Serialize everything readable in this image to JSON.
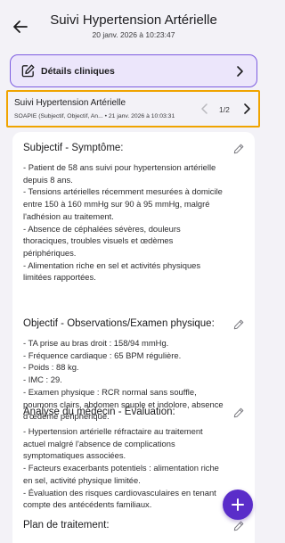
{
  "header": {
    "title": "Suivi Hypertension Artérielle",
    "subtitle": "20 janv. 2026 à 10:23:47"
  },
  "details": {
    "label": "Détails cliniques"
  },
  "note": {
    "title": "Suivi Hypertension Artérielle",
    "format": "SOAPIE (Subjectif, Objectif, Analyse, Plan, Intervention, Évaluation)",
    "format_display": "SOAPIE (Subjectif, Objectif, An...",
    "separator": "•",
    "date": "21 janv. 2026 à 10:03:31",
    "page": "1/2"
  },
  "sections": [
    {
      "title": "Subjectif - Symptôme:",
      "lines": [
        "- Patient de 58 ans suivi pour hypertension artérielle",
        "depuis 8 ans.",
        "- Tensions artérielles récemment mesurées à domicile",
        "entre 150 à 160 mmHg sur 90 à 95 mmHg, malgré",
        "l'adhésion au traitement.",
        "- Absence de céphalées sévères, douleurs",
        "thoraciques, troubles visuels et œdèmes",
        "périphériques.",
        "- Alimentation riche en sel et activités physiques",
        "limitées rapportées."
      ]
    },
    {
      "title": "Objectif - Observations/Examen physique:",
      "lines": [
        "- TA prise au bras droit : 158/94 mmHg.",
        "- Fréquence cardiaque : 65 BPM régulière.",
        "- Poids : 88 kg.",
        "- IMC : 29.",
        "- Examen physique : RCR normal sans souffle,",
        "poumons clairs, abdomen souple et indolore, absence",
        "d'œdème périphérique."
      ]
    },
    {
      "title": "Analyse du médecin - Évaluation:",
      "lines": [
        "- Hypertension artérielle réfractaire au traitement",
        "actuel malgré l'absence de complications",
        "symptomatiques associées.",
        "- Facteurs exacerbants potentiels : alimentation riche",
        "en sel, activité physique limitée.",
        "- Évaluation des risques cardiovasculaires en tenant",
        "compte des antécédents familiaux."
      ]
    },
    {
      "title": "Plan de traitement:",
      "lines": []
    }
  ],
  "colors": {
    "accent": "#5a2dc9",
    "highlight_border": "#f0a400",
    "details_bg": "#ece6fb"
  },
  "icons": {
    "back": "arrow-left-icon",
    "details": "edit-square-icon",
    "chevron": "chevron-right-icon",
    "prev": "chevron-left-icon",
    "next": "chevron-right-icon",
    "edit": "pencil-icon",
    "add": "plus-icon"
  }
}
